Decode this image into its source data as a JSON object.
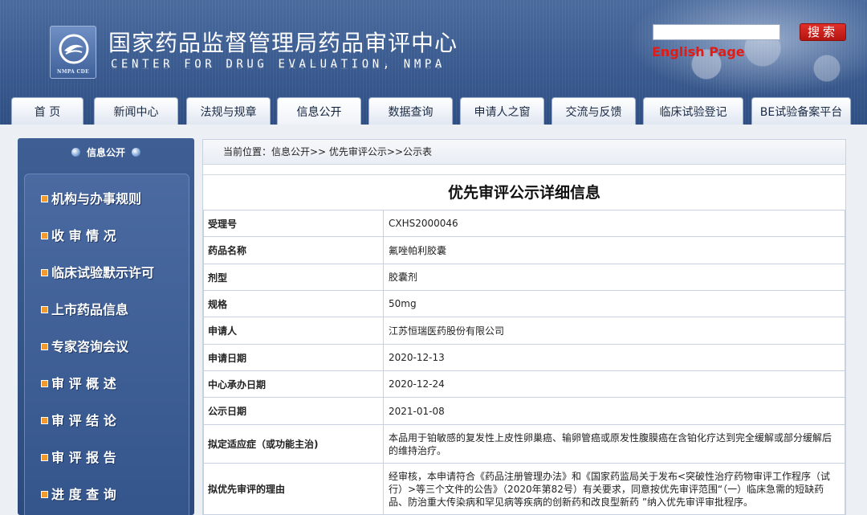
{
  "header": {
    "logo_text": "NMPA CDE",
    "title": "国家药品监督管理局药品审评中心",
    "subtitle": "CENTER FOR DRUG EVALUATION, NMPA",
    "search_placeholder": "",
    "search_label": "搜索",
    "english_link": "English Page"
  },
  "nav": {
    "tabs": [
      {
        "label": "首  页"
      },
      {
        "label": "新闻中心"
      },
      {
        "label": "法规与规章"
      },
      {
        "label": "信息公开"
      },
      {
        "label": "数据查询"
      },
      {
        "label": "申请人之窗"
      },
      {
        "label": "交流与反馈"
      },
      {
        "label": "临床试验登记"
      },
      {
        "label": "BE试验备案平台"
      }
    ],
    "active": "信息公开"
  },
  "sidebar": {
    "title": "信息公开",
    "items": [
      {
        "label": "机构与办事规则"
      },
      {
        "label": "收  审  情  况"
      },
      {
        "label": "临床试验默示许可"
      },
      {
        "label": "上市药品信息"
      },
      {
        "label": "专家咨询会议"
      },
      {
        "label": "审  评  概  述"
      },
      {
        "label": "审  评  结  论"
      },
      {
        "label": "审  评  报  告"
      },
      {
        "label": "进  度  查  询"
      }
    ]
  },
  "main": {
    "breadcrumb": "当前位置：信息公开>> 优先审评公示>>公示表",
    "title": "优先审评公示详细信息",
    "rows": [
      {
        "key": "受理号",
        "value": "CXHS2000046"
      },
      {
        "key": "药品名称",
        "value": "氟唑帕利胶囊"
      },
      {
        "key": "剂型",
        "value": "胶囊剂"
      },
      {
        "key": "规格",
        "value": "50mg"
      },
      {
        "key": "申请人",
        "value": "江苏恒瑞医药股份有限公司"
      },
      {
        "key": "申请日期",
        "value": "2020-12-13"
      },
      {
        "key": "中心承办日期",
        "value": "2020-12-24"
      },
      {
        "key": "公示日期",
        "value": "2021-01-08"
      },
      {
        "key": "拟定适应症（或功能主治)",
        "value": "本品用于铂敏感的复发性上皮性卵巢癌、输卵管癌或原发性腹膜癌在含铂化疗达到完全缓解或部分缓解后的维持治疗。"
      },
      {
        "key": "拟优先审评的理由",
        "value": "经审核，本申请符合《药品注册管理办法》和《国家药监局关于发布<突破性治疗药物审评工作程序（试行）>等三个文件的公告》（2020年第82号）有关要求，同意按优先审评范围“（一）临床急需的短缺药品、防治重大传染病和罕见病等疾病的创新药和改良型新药 ”纳入优先审评审批程序。"
      }
    ]
  },
  "colors": {
    "header_blue": "#3c5d92",
    "search_red": "#c91e18",
    "english_red": "#e21c14",
    "menu_orange": "#f29a2e"
  }
}
